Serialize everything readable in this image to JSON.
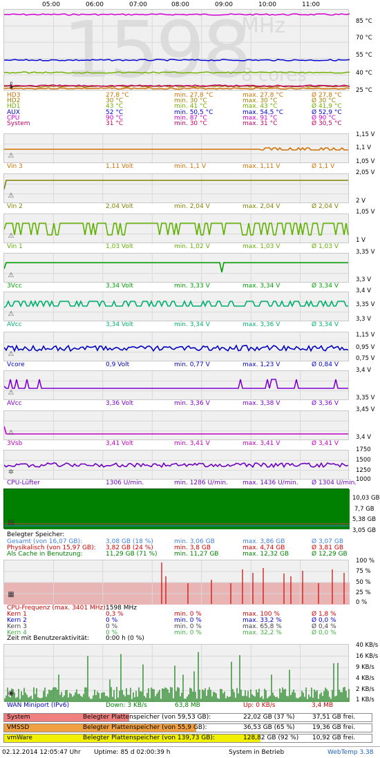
{
  "time_axis": [
    "05:00",
    "06:00",
    "07:00",
    "08:00",
    "09:00",
    "10:00",
    "11:00"
  ],
  "watermark": {
    "big": "1598",
    "unit": "MHz",
    "cores": "8 cores"
  },
  "temp": {
    "axis": [
      "85 °C",
      "70 °C",
      "55 °C",
      "40 °C",
      "25 °C"
    ],
    "rows": [
      {
        "name": "HD3",
        "cur": "27,8 °C",
        "min": "min. 27,8 °C",
        "max": "max. 27,8 °C",
        "avg": "Ø 27,8 °C",
        "color": "#d07000"
      },
      {
        "name": "HD2",
        "cur": "30 °C",
        "min": "min. 30 °C",
        "max": "max. 30 °C",
        "avg": "Ø 30 °C",
        "color": "#a08000"
      },
      {
        "name": "HD1",
        "cur": "43 °C",
        "min": "min. 41 °C",
        "max": "max. 43 °C",
        "avg": "Ø 41,9 °C",
        "color": "#70b000"
      },
      {
        "name": "AUX",
        "cur": "52 °C",
        "min": "min. 50,5 °C",
        "max": "max. 54,5 °C",
        "avg": "Ø 52,9 °C",
        "color": "#0000d0"
      },
      {
        "name": "CPU",
        "cur": "90 °C",
        "min": "min. 87 °C",
        "max": "max. 91 °C",
        "avg": "Ø 90 °C",
        "color": "#d000d0"
      },
      {
        "name": "System",
        "cur": "31 °C",
        "min": "min. 30 °C",
        "max": "max. 31 °C",
        "avg": "Ø 30,5 °C",
        "color": "#c00060"
      }
    ]
  },
  "volt": [
    {
      "name": "Vin 3",
      "cur": "1,11 Volt",
      "min": "min. 1,1 V",
      "max": "max. 1,11 V",
      "avg": "Ø 1,1 V",
      "color": "#d07000",
      "axis": [
        "1,15 V",
        "1,1 V",
        "1,05 V"
      ]
    },
    {
      "name": "Vin 2",
      "cur": "2,04 Volt",
      "min": "min. 2,04 V",
      "max": "max. 2,04 V",
      "avg": "Ø 2,04 V",
      "color": "#808000",
      "axis": [
        "2,05 V",
        "2 V"
      ]
    },
    {
      "name": "Vin 1",
      "cur": "1,03 Volt",
      "min": "min. 1,02 V",
      "max": "max. 1,03 V",
      "avg": "Ø 1,03 V",
      "color": "#60b000",
      "axis": [
        "1,05 V",
        "1 V"
      ]
    },
    {
      "name": "3Vcc",
      "cur": "3,34 Volt",
      "min": "min. 3,33 V",
      "max": "max. 3,34 V",
      "avg": "Ø 3,34 V",
      "color": "#00a000",
      "axis": [
        "3,35 V",
        "3,3 V"
      ]
    },
    {
      "name": "AVcc",
      "cur": "3,34 Volt",
      "min": "min. 3,34 V",
      "max": "max. 3,36 V",
      "avg": "Ø 3,34 V",
      "color": "#00b070",
      "axis": [
        "3,4 V",
        "3,35 V",
        "3,3 V"
      ]
    },
    {
      "name": "Vcore",
      "cur": "0,9 Volt",
      "min": "min. 0,77 V",
      "max": "max. 1,23 V",
      "avg": "Ø 0,84 V",
      "color": "#0000c0",
      "axis": [
        "1,15 V",
        "0,95 V",
        "0,75 V"
      ]
    },
    {
      "name": "AVcc",
      "cur": "3,36 Volt",
      "min": "min. 3,36 V",
      "max": "max. 3,38 V",
      "avg": "Ø 3,36 V",
      "color": "#8000d0",
      "axis": [
        "3,4 V",
        "3,35 V"
      ]
    },
    {
      "name": "3Vsb",
      "cur": "3,41 Volt",
      "min": "min. 3,41 V",
      "max": "max. 3,41 V",
      "avg": "Ø 3,41 V",
      "color": "#c000c0",
      "axis": [
        "3,45 V",
        "3,4 V"
      ]
    }
  ],
  "fan": {
    "name": "CPU-Lüfter",
    "cur": "1306 U/min.",
    "min": "min. 1286 U/min.",
    "max": "max. 1436 U/min.",
    "avg": "Ø 1304 U/min.",
    "color": "#7000c0",
    "axis": [
      "1750",
      "1500",
      "1250",
      "1000"
    ]
  },
  "mem": {
    "axis": [
      "10,03 GB",
      "7,7 GB",
      "5,38 GB",
      "3,05 GB"
    ],
    "title": "Belegter Speicher:",
    "rows": [
      {
        "name": "Gesamt (von 16,07 GB):",
        "cur": "3,08 GB (18 %)",
        "min": "min. 3,06 GB",
        "max": "max. 3,86 GB",
        "avg": "Ø 3,07 GB",
        "color": "#4080e0"
      },
      {
        "name": "Physikalisch (von 15,97 GB):",
        "cur": "3,82 GB (24 %)",
        "min": "min. 3,8 GB",
        "max": "max. 4,74 GB",
        "avg": "Ø 3,81 GB",
        "color": "#d00000"
      },
      {
        "name": "Als Cache in Benutzung:",
        "cur": "11,29 GB (71 %)",
        "min": "min. 11,27 GB",
        "max": "max. 12,32 GB",
        "avg": "Ø 12,29 GB",
        "color": "#008000"
      }
    ]
  },
  "cpu": {
    "axis": [
      "100 %",
      "75 %",
      "50 %",
      "25 %",
      "0 %"
    ],
    "freq_label": "CPU-Frequenz (max. 3401 MHz):",
    "freq": "1598 MHz",
    "rows": [
      {
        "name": "Kern 1",
        "cur": "0,3 %",
        "min": "min. 0 %",
        "max": "max. 100 %",
        "avg": "Ø 1,8 %",
        "color": "#d00000"
      },
      {
        "name": "Kern 2",
        "cur": "0 %",
        "min": "min. 0 %",
        "max": "max. 33,2 %",
        "avg": "Ø 0,0 %",
        "color": "#0000d0"
      },
      {
        "name": "Kern 3",
        "cur": "0 %",
        "min": "min. 0 %",
        "max": "max. 65,8 %",
        "avg": "Ø 0,4 %",
        "color": "#404040"
      },
      {
        "name": "Kern 4",
        "cur": "0 %",
        "min": "min. 0 %",
        "max": "max. 32,2 %",
        "avg": "Ø 0,0 %",
        "color": "#40b040"
      }
    ],
    "idle_label": "Zeit mit Benutzeraktivität:",
    "idle": "0:00 h (0 %)"
  },
  "net": {
    "axis": [
      "40 KB/s",
      "16 KB/s",
      "9 KB/s",
      "4 KB/s",
      "2 KB/s",
      "1 KB/s"
    ],
    "name": "WAN Miniport (IPv6)",
    "down": "Down: 3 KB/s",
    "down_total": "63,8 MB",
    "up": "Up: 0 KB/s",
    "up_total": "3,4 MB"
  },
  "disks": [
    {
      "name": "System",
      "label": "Belegter Plattenspeicher (von 59,53 GB):",
      "used": "22,02 GB (37 %)",
      "free": "37,51 GB frei.",
      "pct": 37,
      "color": "#f08080"
    },
    {
      "name": "VMSSD",
      "label": "Belegter Plattenspeicher (von 55,9 GB):",
      "used": "36,53 GB (65 %)",
      "free": "19,36 GB frei.",
      "pct": 65,
      "color": "#f0a040"
    },
    {
      "name": "vmWare",
      "label": "Belegter Plattenspeicher (von 139,73 GB):",
      "used": "128,82 GB (92 %)",
      "free": "10,92 GB frei.",
      "pct": 92,
      "color": "#f0f000"
    }
  ],
  "footer": {
    "datetime": "02.12.2014 12:05:47 Uhr",
    "uptime": "Uptime: 85 d 02:00:39 h",
    "status": "System in Betrieb",
    "app": "WebTemp 3.38"
  }
}
